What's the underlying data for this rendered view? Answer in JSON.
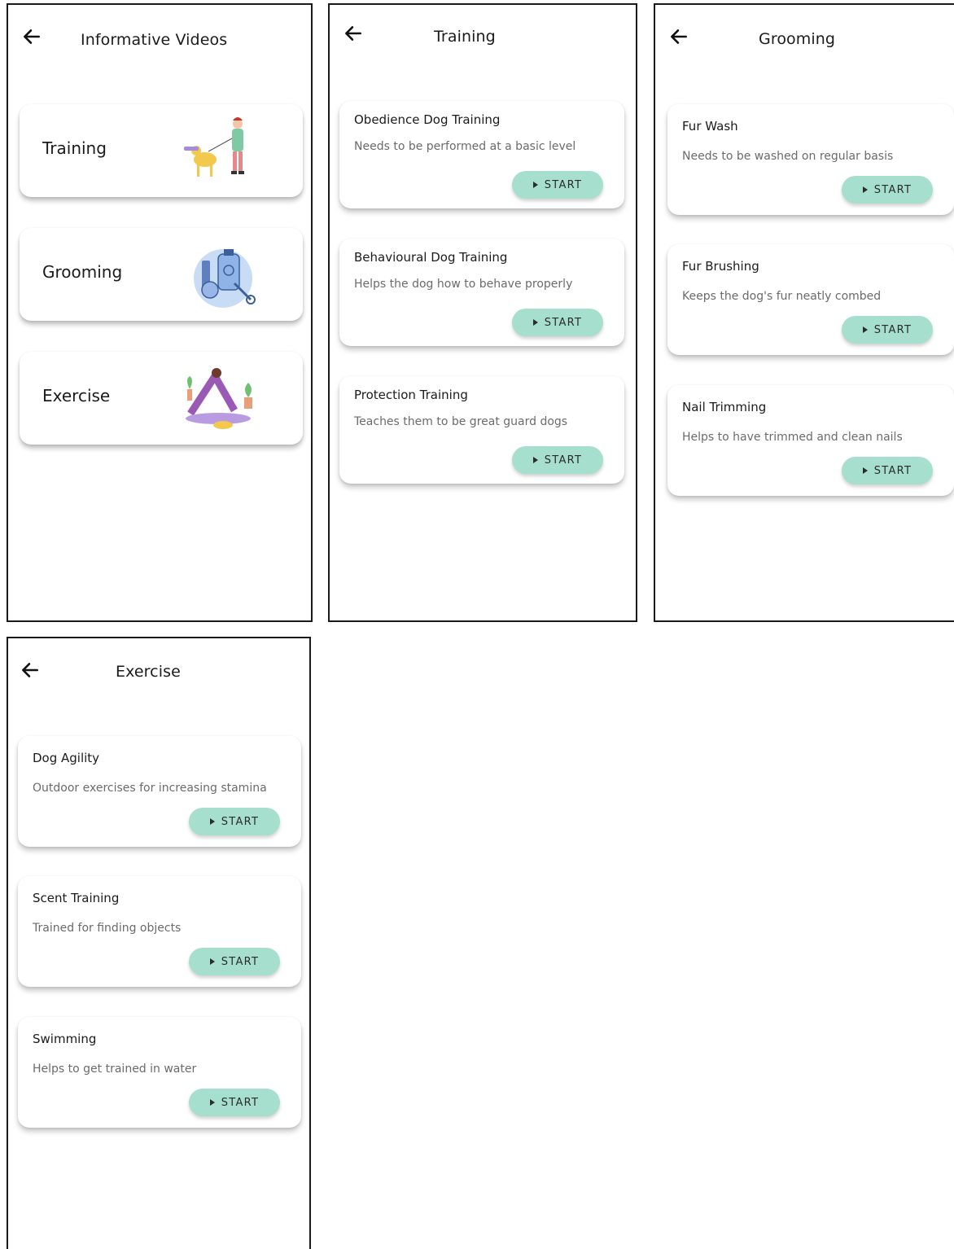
{
  "screens": {
    "home": {
      "title": "Informative Videos",
      "items": [
        {
          "label": "Training",
          "icon": "dog-walking-illustration"
        },
        {
          "label": "Grooming",
          "icon": "grooming-tools-illustration"
        },
        {
          "label": "Exercise",
          "icon": "dog-yoga-illustration"
        }
      ]
    },
    "training": {
      "title": "Training",
      "cards": [
        {
          "title": "Obedience Dog Training",
          "desc": "Needs to be performed at a basic level",
          "button": "START"
        },
        {
          "title": "Behavioural Dog Training",
          "desc": "Helps the dog how to behave properly",
          "button": "START"
        },
        {
          "title": "Protection Training",
          "desc": "Teaches them to be great guard dogs",
          "button": "START"
        }
      ]
    },
    "grooming": {
      "title": "Grooming",
      "cards": [
        {
          "title": "Fur Wash",
          "desc": "Needs to be washed on regular basis",
          "button": "START"
        },
        {
          "title": "Fur Brushing",
          "desc": "Keeps the dog's fur neatly combed",
          "button": "START"
        },
        {
          "title": "Nail Trimming",
          "desc": "Helps to have trimmed and clean nails",
          "button": "START"
        }
      ]
    },
    "exercise": {
      "title": "Exercise",
      "cards": [
        {
          "title": "Dog Agility",
          "desc": "Outdoor exercises for increasing stamina",
          "button": "START"
        },
        {
          "title": "Scent Training",
          "desc": "Trained for finding objects",
          "button": "START"
        },
        {
          "title": "Swimming",
          "desc": "Helps to get trained in water",
          "button": "START"
        }
      ]
    }
  },
  "colors": {
    "button": "#a6dfcd",
    "border": "#1a1a1a",
    "text": "#1b1b1b",
    "muted": "#6b6b6b"
  }
}
